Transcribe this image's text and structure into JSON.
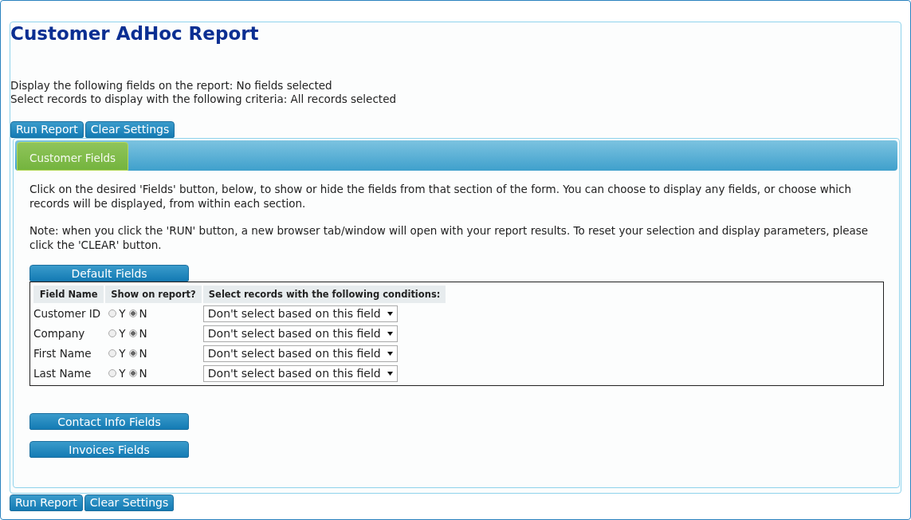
{
  "title": "Customer AdHoc Report",
  "summary": [
    "Display the following fields on the report: No fields selected",
    "Select records to display with the following criteria: All records selected"
  ],
  "top_buttons": [
    "Run Report",
    "Clear Settings"
  ],
  "tabs": [
    {
      "label": "Customer Fields",
      "selected": true
    }
  ],
  "intro": [
    "Click on the desired 'Fields' button, below, to show or hide the fields from that section of the form. You can choose to display any fields, or choose which records will be displayed, from within each section.",
    "Note: when you click the 'RUN' button, a new browser tab/window will open with your report results. To reset your selection and display parameters, please click the 'CLEAR' button."
  ],
  "sections": [
    {
      "label": "Default Fields",
      "expanded": true,
      "columns": [
        "Field Name",
        "Show on report?",
        "Select records with the following conditions:"
      ],
      "rows": [
        {
          "name": "Customer ID",
          "options": [
            {
              "label": "Y",
              "selected": false
            },
            {
              "label": "N",
              "selected": true
            }
          ],
          "condition": "Don't select based on this field"
        },
        {
          "name": "Company",
          "options": [
            {
              "label": "Y",
              "selected": false
            },
            {
              "label": "N",
              "selected": true
            }
          ],
          "condition": "Don't select based on this field"
        },
        {
          "name": "First Name",
          "options": [
            {
              "label": "Y",
              "selected": false
            },
            {
              "label": "N",
              "selected": true
            }
          ],
          "condition": "Don't select based on this field"
        },
        {
          "name": "Last Name",
          "options": [
            {
              "label": "Y",
              "selected": false
            },
            {
              "label": "N",
              "selected": true
            }
          ],
          "condition": "Don't select based on this field"
        }
      ]
    },
    {
      "label": "Contact Info Fields",
      "expanded": false
    },
    {
      "label": "Invoices Fields",
      "expanded": false
    }
  ],
  "bottom_buttons": [
    "Run Report",
    "Clear Settings"
  ]
}
